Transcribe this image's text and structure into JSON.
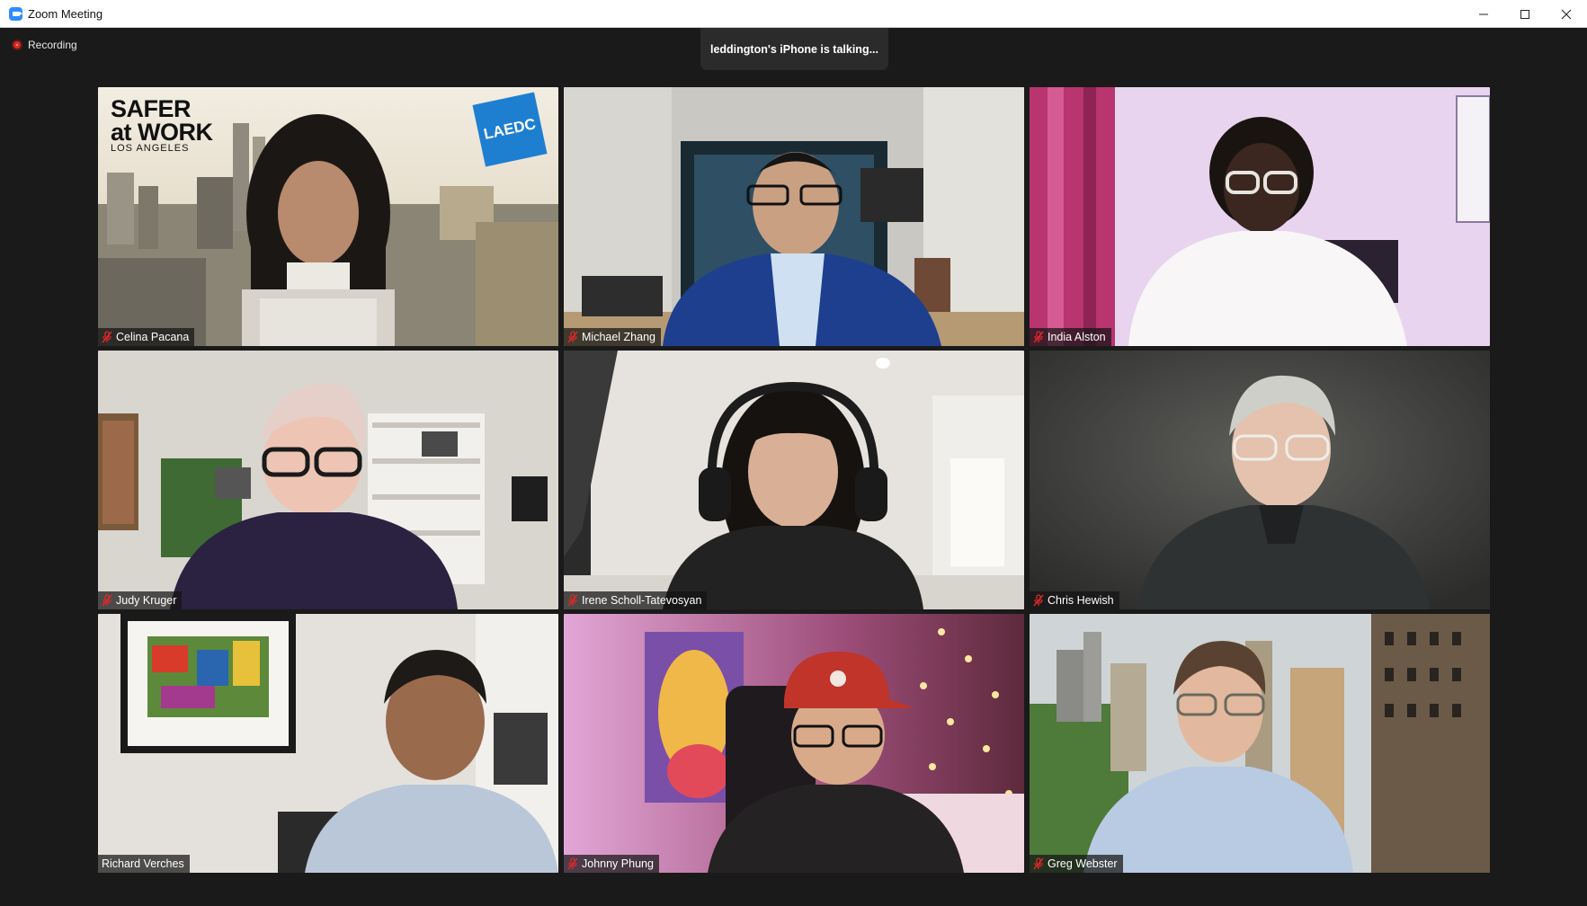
{
  "window": {
    "title": "Zoom Meeting",
    "app_icon": "zoom-camera-icon"
  },
  "meeting": {
    "recording_label": "Recording",
    "talking_indicator": "leddington's iPhone is talking...",
    "colors": {
      "background": "#1a1a1a",
      "recording_dot": "#e02828",
      "muted_icon": "#e02828"
    }
  },
  "participants": [
    {
      "name": "Celina Pacana",
      "muted": true
    },
    {
      "name": "Michael Zhang",
      "muted": true
    },
    {
      "name": "India Alston",
      "muted": true
    },
    {
      "name": "Judy Kruger",
      "muted": true
    },
    {
      "name": "Irene Scholl-Tatevosyan",
      "muted": true
    },
    {
      "name": "Chris Hewish",
      "muted": true
    },
    {
      "name": "Richard Verches",
      "muted": false
    },
    {
      "name": "Johnny Phung",
      "muted": true
    },
    {
      "name": "Greg Webster",
      "muted": true
    }
  ],
  "backgrounds": {
    "safer_line1": "SAFER",
    "safer_line2": "at WORK",
    "safer_line3": "LOS ANGELES",
    "laedc": "LAEDC"
  }
}
